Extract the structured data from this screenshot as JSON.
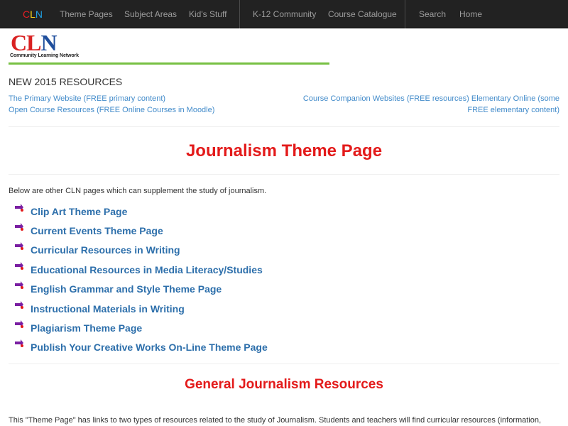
{
  "navbar": {
    "brand": {
      "c": "C",
      "l": "L",
      "n": "N"
    },
    "items": [
      {
        "label": "Theme Pages"
      },
      {
        "label": "Subject Areas"
      },
      {
        "label": "Kid's Stuff"
      },
      {
        "label": "K-12 Community"
      },
      {
        "label": "Course Catalogue"
      },
      {
        "label": "Search"
      },
      {
        "label": "Home"
      }
    ]
  },
  "logo": {
    "letters": {
      "c": "C",
      "l": "L",
      "n": "N"
    },
    "tagline": "Community Learning Network"
  },
  "new_resources": {
    "title": "NEW 2015 RESOURCES",
    "left_links": [
      "The Primary Website (FREE primary content)",
      "Open Course Resources (FREE Online Courses in Moodle)"
    ],
    "right_text_line1": "Course Companion Websites (FREE resources) Elementary Online (some",
    "right_text_line2": "FREE elementary content)"
  },
  "page_title": "Journalism Theme Page",
  "intro": "Below are other CLN pages which can supplement the study of journalism.",
  "related_links": [
    "Clip Art Theme Page",
    "Current Events Theme Page",
    "Curricular Resources in Writing",
    "Educational Resources in Media Literacy/Studies",
    "English Grammar and Style Theme Page",
    "Instructional Materials in Writing",
    "Plagiarism Theme Page",
    "Publish Your Creative Works On-Line Theme Page"
  ],
  "section_heading": "General Journalism Resources",
  "bottom_text": "This \"Theme Page\" has links to two types of resources related to the study of Journalism. Students and teachers will find curricular resources (information,",
  "colors": {
    "navbar_bg": "#222222",
    "nav_text": "#9d9d9d",
    "link_blue": "#428bca",
    "heading_red": "#e31a1a",
    "green_rule": "#77c043"
  },
  "icons": {
    "bullet": "arrow-bullet-icon"
  }
}
